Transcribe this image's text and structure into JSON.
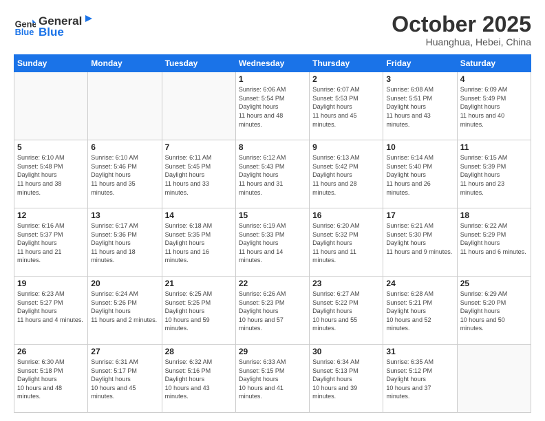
{
  "header": {
    "logo_general": "General",
    "logo_blue": "Blue",
    "month_title": "October 2025",
    "location": "Huanghua, Hebei, China"
  },
  "weekdays": [
    "Sunday",
    "Monday",
    "Tuesday",
    "Wednesday",
    "Thursday",
    "Friday",
    "Saturday"
  ],
  "weeks": [
    [
      {
        "day": "",
        "empty": true
      },
      {
        "day": "",
        "empty": true
      },
      {
        "day": "",
        "empty": true
      },
      {
        "day": "1",
        "sunrise": "6:06 AM",
        "sunset": "5:54 PM",
        "daylight": "11 hours and 48 minutes."
      },
      {
        "day": "2",
        "sunrise": "6:07 AM",
        "sunset": "5:53 PM",
        "daylight": "11 hours and 45 minutes."
      },
      {
        "day": "3",
        "sunrise": "6:08 AM",
        "sunset": "5:51 PM",
        "daylight": "11 hours and 43 minutes."
      },
      {
        "day": "4",
        "sunrise": "6:09 AM",
        "sunset": "5:49 PM",
        "daylight": "11 hours and 40 minutes."
      }
    ],
    [
      {
        "day": "5",
        "sunrise": "6:10 AM",
        "sunset": "5:48 PM",
        "daylight": "11 hours and 38 minutes."
      },
      {
        "day": "6",
        "sunrise": "6:10 AM",
        "sunset": "5:46 PM",
        "daylight": "11 hours and 35 minutes."
      },
      {
        "day": "7",
        "sunrise": "6:11 AM",
        "sunset": "5:45 PM",
        "daylight": "11 hours and 33 minutes."
      },
      {
        "day": "8",
        "sunrise": "6:12 AM",
        "sunset": "5:43 PM",
        "daylight": "11 hours and 31 minutes."
      },
      {
        "day": "9",
        "sunrise": "6:13 AM",
        "sunset": "5:42 PM",
        "daylight": "11 hours and 28 minutes."
      },
      {
        "day": "10",
        "sunrise": "6:14 AM",
        "sunset": "5:40 PM",
        "daylight": "11 hours and 26 minutes."
      },
      {
        "day": "11",
        "sunrise": "6:15 AM",
        "sunset": "5:39 PM",
        "daylight": "11 hours and 23 minutes."
      }
    ],
    [
      {
        "day": "12",
        "sunrise": "6:16 AM",
        "sunset": "5:37 PM",
        "daylight": "11 hours and 21 minutes."
      },
      {
        "day": "13",
        "sunrise": "6:17 AM",
        "sunset": "5:36 PM",
        "daylight": "11 hours and 18 minutes."
      },
      {
        "day": "14",
        "sunrise": "6:18 AM",
        "sunset": "5:35 PM",
        "daylight": "11 hours and 16 minutes."
      },
      {
        "day": "15",
        "sunrise": "6:19 AM",
        "sunset": "5:33 PM",
        "daylight": "11 hours and 14 minutes."
      },
      {
        "day": "16",
        "sunrise": "6:20 AM",
        "sunset": "5:32 PM",
        "daylight": "11 hours and 11 minutes."
      },
      {
        "day": "17",
        "sunrise": "6:21 AM",
        "sunset": "5:30 PM",
        "daylight": "11 hours and 9 minutes."
      },
      {
        "day": "18",
        "sunrise": "6:22 AM",
        "sunset": "5:29 PM",
        "daylight": "11 hours and 6 minutes."
      }
    ],
    [
      {
        "day": "19",
        "sunrise": "6:23 AM",
        "sunset": "5:27 PM",
        "daylight": "11 hours and 4 minutes."
      },
      {
        "day": "20",
        "sunrise": "6:24 AM",
        "sunset": "5:26 PM",
        "daylight": "11 hours and 2 minutes."
      },
      {
        "day": "21",
        "sunrise": "6:25 AM",
        "sunset": "5:25 PM",
        "daylight": "10 hours and 59 minutes."
      },
      {
        "day": "22",
        "sunrise": "6:26 AM",
        "sunset": "5:23 PM",
        "daylight": "10 hours and 57 minutes."
      },
      {
        "day": "23",
        "sunrise": "6:27 AM",
        "sunset": "5:22 PM",
        "daylight": "10 hours and 55 minutes."
      },
      {
        "day": "24",
        "sunrise": "6:28 AM",
        "sunset": "5:21 PM",
        "daylight": "10 hours and 52 minutes."
      },
      {
        "day": "25",
        "sunrise": "6:29 AM",
        "sunset": "5:20 PM",
        "daylight": "10 hours and 50 minutes."
      }
    ],
    [
      {
        "day": "26",
        "sunrise": "6:30 AM",
        "sunset": "5:18 PM",
        "daylight": "10 hours and 48 minutes."
      },
      {
        "day": "27",
        "sunrise": "6:31 AM",
        "sunset": "5:17 PM",
        "daylight": "10 hours and 45 minutes."
      },
      {
        "day": "28",
        "sunrise": "6:32 AM",
        "sunset": "5:16 PM",
        "daylight": "10 hours and 43 minutes."
      },
      {
        "day": "29",
        "sunrise": "6:33 AM",
        "sunset": "5:15 PM",
        "daylight": "10 hours and 41 minutes."
      },
      {
        "day": "30",
        "sunrise": "6:34 AM",
        "sunset": "5:13 PM",
        "daylight": "10 hours and 39 minutes."
      },
      {
        "day": "31",
        "sunrise": "6:35 AM",
        "sunset": "5:12 PM",
        "daylight": "10 hours and 37 minutes."
      },
      {
        "day": "",
        "empty": true
      }
    ]
  ]
}
